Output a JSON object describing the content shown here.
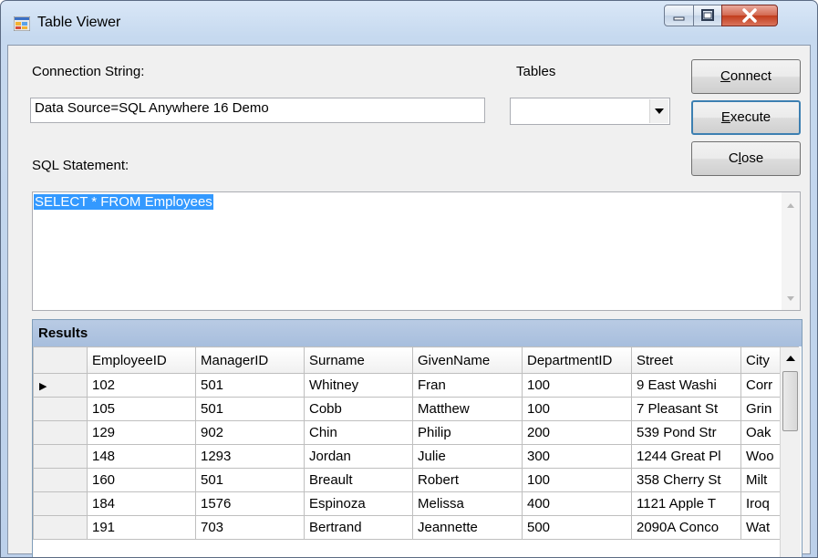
{
  "window": {
    "title": "Table Viewer",
    "app_icon": "window-app-icon"
  },
  "connection": {
    "label": "Connection String:",
    "value": "Data Source=SQL Anywhere 16 Demo"
  },
  "tables": {
    "label": "Tables",
    "selected": ""
  },
  "buttons": {
    "connect": {
      "label": "Connect",
      "mnemonic": "C"
    },
    "execute": {
      "label": "Execute",
      "mnemonic": "E"
    },
    "close": {
      "label": "Close",
      "mnemonic": "l"
    }
  },
  "sql": {
    "label": "SQL Statement:",
    "text": "SELECT * FROM Employees"
  },
  "results": {
    "caption": "Results",
    "columns": [
      "EmployeeID",
      "ManagerID",
      "Surname",
      "GivenName",
      "DepartmentID",
      "Street",
      "City"
    ],
    "rows": [
      [
        "102",
        "501",
        "Whitney",
        "Fran",
        "100",
        "9 East Washi",
        "Corr"
      ],
      [
        "105",
        "501",
        "Cobb",
        "Matthew",
        "100",
        "7 Pleasant St",
        "Grin"
      ],
      [
        "129",
        "902",
        "Chin",
        "Philip",
        "200",
        "539 Pond Str",
        "Oak"
      ],
      [
        "148",
        "1293",
        "Jordan",
        "Julie",
        "300",
        "1244 Great Pl",
        "Woo"
      ],
      [
        "160",
        "501",
        "Breault",
        "Robert",
        "100",
        "358 Cherry St",
        "Milt"
      ],
      [
        "184",
        "1576",
        "Espinoza",
        "Melissa",
        "400",
        "1121 Apple T",
        "Iroq"
      ],
      [
        "191",
        "703",
        "Bertrand",
        "Jeannette",
        "500",
        "2090A Conco",
        "Wat"
      ]
    ],
    "current_row_marker": "▶"
  },
  "colors": {
    "selection": "#3399ff",
    "results_header": "#a7bedd",
    "close_button": "#c23c1d"
  }
}
